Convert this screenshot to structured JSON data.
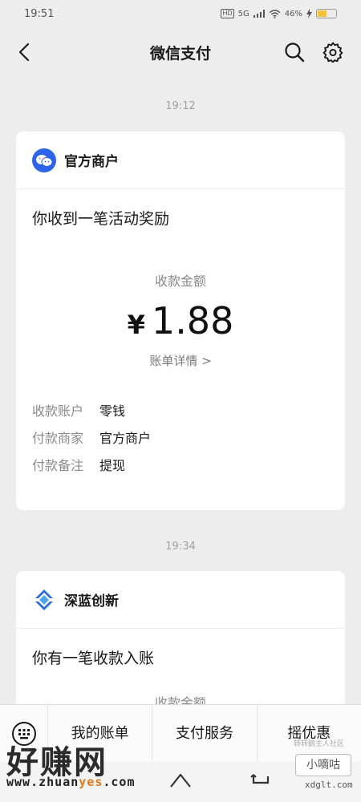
{
  "status_bar": {
    "time": "19:51",
    "hd": "HD",
    "network": "5G",
    "battery": "46%"
  },
  "nav": {
    "title": "微信支付"
  },
  "messages": [
    {
      "time": "19:12",
      "merchant": "官方商户",
      "title": "你收到一笔活动奖励",
      "amount_label": "收款金额",
      "currency": "¥",
      "amount": "1.88",
      "detail_link": "账单详情 >",
      "info": [
        {
          "key": "收款账户",
          "value": "零钱"
        },
        {
          "key": "付款商家",
          "value": "官方商户"
        },
        {
          "key": "付款备注",
          "value": "提现"
        }
      ]
    },
    {
      "time": "19:34",
      "merchant": "深蓝创新",
      "title": "你有一笔收款入账",
      "amount_label": "收款金额"
    }
  ],
  "bottom_menu": {
    "items": [
      "我的账单",
      "支付服务",
      "摇优惠"
    ]
  },
  "watermark": {
    "brand": "好赚网",
    "url_prefix": "www.zhuan",
    "url_accent": "yes",
    "url_suffix": ".com"
  },
  "badge": {
    "small": "转转鹅主人社区",
    "name": "小嘀咕",
    "site": "xdglt.com"
  },
  "colors": {
    "background": "#ededed",
    "card": "#ffffff",
    "muted": "#8a8a8a",
    "logo_blue": "#2c64e8",
    "accent_orange": "#e07a1c"
  }
}
